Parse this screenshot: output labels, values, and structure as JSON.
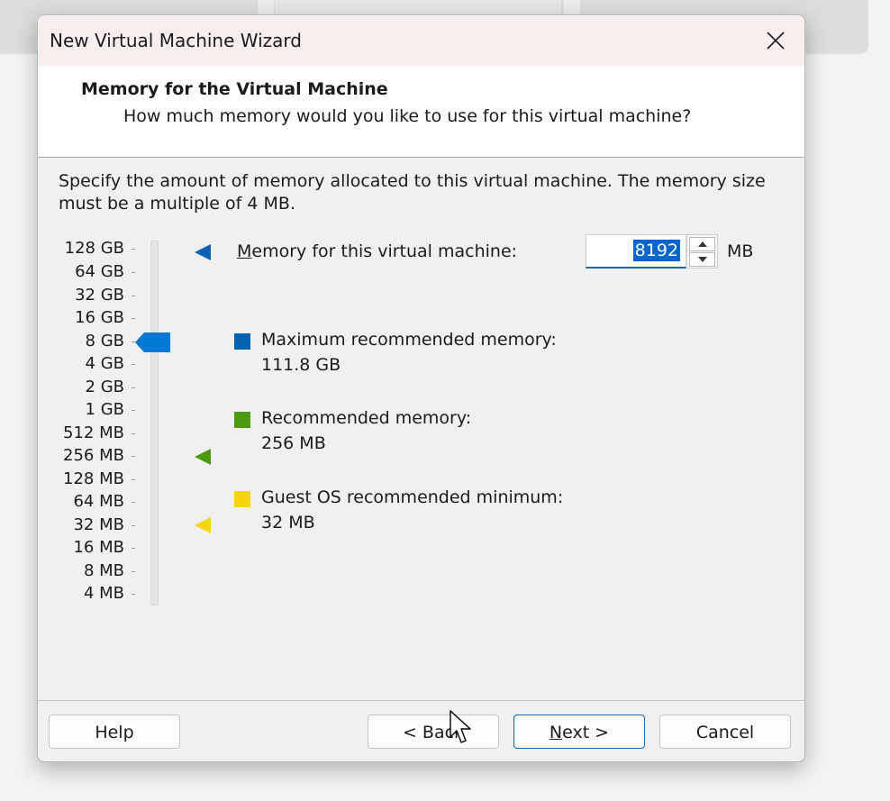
{
  "window": {
    "title": "New Virtual Machine Wizard"
  },
  "header": {
    "title": "Memory for the Virtual Machine",
    "subtitle": "How much memory would you like to use for this virtual machine?"
  },
  "description": "Specify the amount of memory allocated to this virtual machine. The memory size must be a multiple of 4 MB.",
  "scale": {
    "labels": [
      "128 GB",
      "64 GB",
      "32 GB",
      "16 GB",
      "8 GB",
      "4 GB",
      "2 GB",
      "1 GB",
      "512 MB",
      "256 MB",
      "128 MB",
      "64 MB",
      "32 MB",
      "16 MB",
      "8 MB",
      "4 MB"
    ],
    "selected": "8 GB"
  },
  "memory": {
    "label_prefix": "M",
    "label_rest": "emory for this virtual machine:",
    "value": "8192",
    "unit": "MB"
  },
  "legend": {
    "max_label": "Maximum recommended memory:",
    "max_value": "111.8 GB",
    "rec_label": "Recommended memory:",
    "rec_value": "256 MB",
    "min_label": "Guest OS recommended minimum:",
    "min_value": "32 MB"
  },
  "colors": {
    "accent": "#0078d4",
    "max": "#0063b1",
    "recommended": "#4c9a12",
    "minimum": "#f6d40e"
  },
  "buttons": {
    "help": "Help",
    "back": "< Back",
    "next_prefix": "N",
    "next_rest": "ext >",
    "cancel": "Cancel"
  }
}
